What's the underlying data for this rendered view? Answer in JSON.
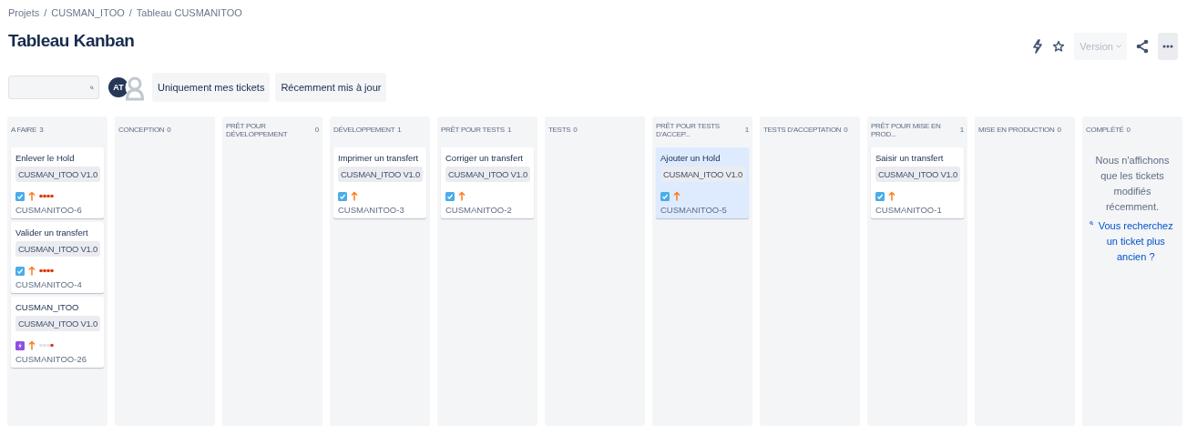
{
  "breadcrumbs": [
    {
      "label": "Projets"
    },
    {
      "separator": "/",
      "label": "CUSMAN_ITOO"
    },
    {
      "separator": "/",
      "label": "Tableau CUSMANITOO"
    }
  ],
  "title": "Tableau Kanban",
  "header_actions": {
    "version": "Version"
  },
  "avatars": [
    {
      "kind": "initials",
      "label": "AT"
    },
    {
      "kind": "silhouette"
    }
  ],
  "filters": [
    {
      "label": "Uniquement mes tickets",
      "selected": false
    },
    {
      "label": "Récemment mis à jour",
      "selected": false
    }
  ],
  "columns": [
    {
      "name": "A FAIRE",
      "count": "3",
      "cards": [
        {
          "summary": "Enlever le Hold",
          "version": "CUSMAN_ITOO V1.0",
          "kind": "task",
          "level": 1,
          "key": "CUSMANITOO-6",
          "selected": false
        },
        {
          "summary": "Valider un transfert",
          "version": "CUSMAN_ITOO V1.0",
          "kind": "task",
          "level": 1,
          "key": "CUSMANITOO-4",
          "selected": false
        },
        {
          "summary": "CUSMAN_ITOO",
          "version": "CUSMAN_ITOO V1.0",
          "kind": "epic",
          "level": 0.25,
          "key": "CUSMANITOO-26",
          "selected": false
        }
      ]
    },
    {
      "name": "CONCEPTION",
      "count": "0"
    },
    {
      "name": "PRÊT POUR DÉVELOPPEMENT",
      "count": "0"
    },
    {
      "name": "DÉVELOPPEMENT",
      "count": "1",
      "cards": [
        {
          "summary": "Imprimer un transfert",
          "version": "CUSMAN_ITOO V1.0",
          "kind": "task",
          "key": "CUSMANITOO-3",
          "selected": false
        }
      ]
    },
    {
      "name": "PRÊT POUR TESTS",
      "count": "1",
      "cards": [
        {
          "summary": "Corriger un transfert",
          "version": "CUSMAN_ITOO V1.0",
          "kind": "task",
          "key": "CUSMANITOO-2",
          "selected": false
        }
      ]
    },
    {
      "name": "TESTS",
      "count": "0"
    },
    {
      "name": "PRÊT POUR TESTS D'ACCEP...",
      "count": "1",
      "cards": [
        {
          "summary": "Ajouter un Hold",
          "version": "CUSMAN_ITOO V1.0",
          "kind": "task",
          "key": "CUSMANITOO-5",
          "selected": true
        }
      ]
    },
    {
      "name": "TESTS D'ACCEPTATION",
      "count": "0"
    },
    {
      "name": "PRÊT POUR MISE EN PROD...",
      "count": "1",
      "cards": [
        {
          "summary": "Saisir un transfert",
          "version": "CUSMAN_ITOO V1.0",
          "kind": "task",
          "key": "CUSMANITOO-1",
          "selected": false
        }
      ]
    },
    {
      "name": "MISE EN PRODUCTION",
      "count": "0"
    },
    {
      "name": "COMPLÉTÉ",
      "count": "0",
      "notice": "Nous n'affichons que les tickets modifiés récemment.",
      "link": "Vous recherchez un ticket plus ancien ?"
    }
  ]
}
